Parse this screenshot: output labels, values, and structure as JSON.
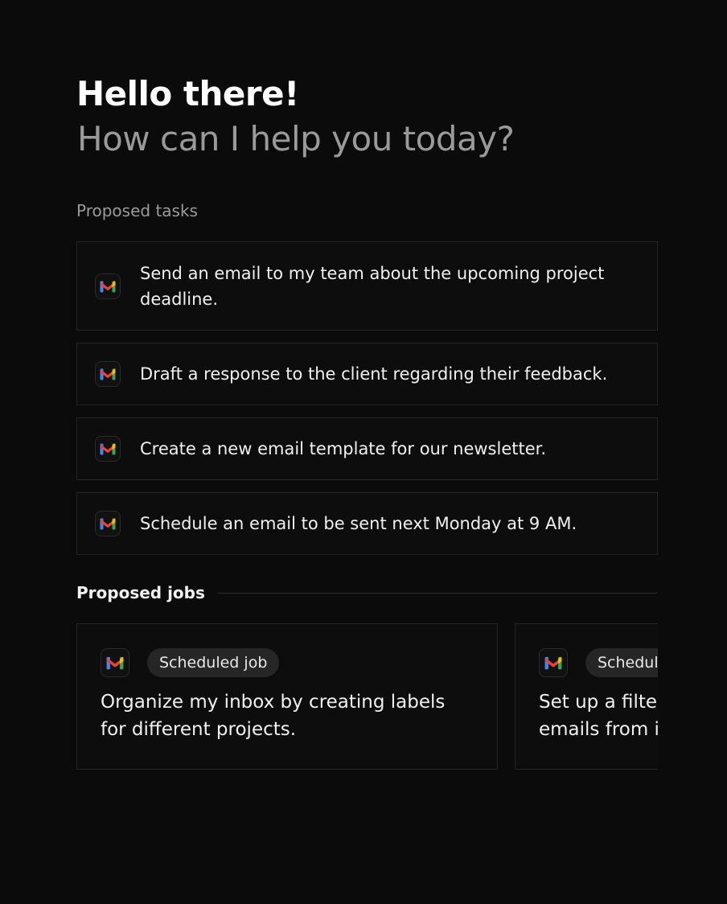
{
  "header": {
    "greeting": "Hello there!",
    "subtitle": "How can I help you today?"
  },
  "tasks": {
    "label": "Proposed tasks",
    "items": [
      {
        "icon": "gmail-icon",
        "text": "Send an email to my team about the upcoming project deadline."
      },
      {
        "icon": "gmail-icon",
        "text": "Draft a response to the client regarding their feedback."
      },
      {
        "icon": "gmail-icon",
        "text": "Create a new email template for our newsletter."
      },
      {
        "icon": "gmail-icon",
        "text": "Schedule an email to be sent next Monday at 9 AM."
      }
    ]
  },
  "jobs": {
    "label": "Proposed jobs",
    "items": [
      {
        "icon": "gmail-icon",
        "badge": "Scheduled job",
        "text": "Organize my inbox by creating labels\nfor different projects."
      },
      {
        "icon": "gmail-icon",
        "badge": "Scheduled job",
        "text": "Set up a filter to automatically label\nemails from important contacts."
      }
    ]
  },
  "colors": {
    "background": "#0b0b0b",
    "card_border": "#242424",
    "muted_text": "#9a9a9a",
    "badge_bg": "#262626"
  }
}
